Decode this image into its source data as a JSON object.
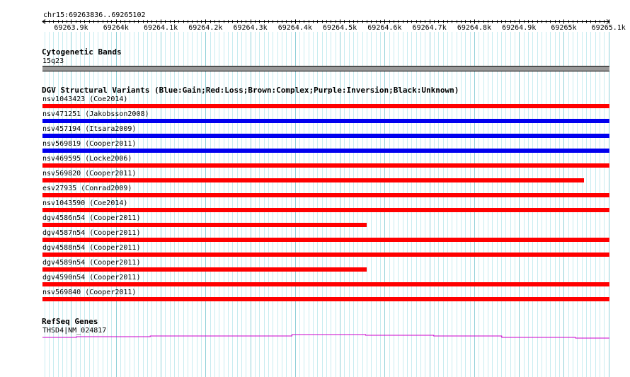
{
  "view": {
    "chr": "chr15",
    "start": 69263836,
    "end": 69265102,
    "range_label": "chr15:69263836..69265102",
    "ticks": [
      {
        "pos": 69263900,
        "label": "69263.9k"
      },
      {
        "pos": 69264000,
        "label": "69264k"
      },
      {
        "pos": 69264100,
        "label": "69264.1k"
      },
      {
        "pos": 69264200,
        "label": "69264.2k"
      },
      {
        "pos": 69264300,
        "label": "69264.3k"
      },
      {
        "pos": 69264400,
        "label": "69264.4k"
      },
      {
        "pos": 69264500,
        "label": "69264.5k"
      },
      {
        "pos": 69264600,
        "label": "69264.6k"
      },
      {
        "pos": 69264700,
        "label": "69264.7k"
      },
      {
        "pos": 69264800,
        "label": "69264.8k"
      },
      {
        "pos": 69264900,
        "label": "69264.9k"
      },
      {
        "pos": 69265000,
        "label": "69265k"
      },
      {
        "pos": 69265100,
        "label": "69265.1k"
      }
    ]
  },
  "cyto": {
    "title": "Cytogenetic Bands",
    "band": "15q23",
    "color": "#999999"
  },
  "dgv": {
    "title": "DGV Structural Variants (Blue:Gain;Red:Loss;Brown:Complex;Purple:Inversion;Black:Unknown)",
    "colors": {
      "Gain": "#0000ee",
      "Loss": "#ff0000"
    },
    "variants": [
      {
        "name": "nsv1043423 (Coe2014)",
        "type": "Loss",
        "end": 69265102
      },
      {
        "name": "nsv471251 (Jakobsson2008)",
        "type": "Gain",
        "end": 69265102
      },
      {
        "name": "nsv457194 (Itsara2009)",
        "type": "Gain",
        "end": 69265102
      },
      {
        "name": "nsv569819 (Cooper2011)",
        "type": "Gain",
        "end": 69265102
      },
      {
        "name": "nsv469595 (Locke2006)",
        "type": "Loss",
        "end": 69265102
      },
      {
        "name": "nsv569820 (Cooper2011)",
        "type": "Loss",
        "end": 69265045
      },
      {
        "name": "esv27935 (Conrad2009)",
        "type": "Loss",
        "end": 69265102
      },
      {
        "name": "nsv1043590 (Coe2014)",
        "type": "Loss",
        "end": 69265102
      },
      {
        "name": "dgv4586n54 (Cooper2011)",
        "type": "Loss",
        "end": 69264560
      },
      {
        "name": "dgv4587n54 (Cooper2011)",
        "type": "Loss",
        "end": 69265102
      },
      {
        "name": "dgv4588n54 (Cooper2011)",
        "type": "Loss",
        "end": 69265102
      },
      {
        "name": "dgv4589n54 (Cooper2011)",
        "type": "Loss",
        "end": 69264560
      },
      {
        "name": "dgv4590n54 (Cooper2011)",
        "type": "Loss",
        "end": 69265102
      },
      {
        "name": "nsv569840 (Cooper2011)",
        "type": "Loss",
        "end": 69265102
      }
    ]
  },
  "refseq": {
    "title": "RefSeq Genes",
    "gene": "THSD4|NM_024817",
    "color": "#cc00cc"
  }
}
